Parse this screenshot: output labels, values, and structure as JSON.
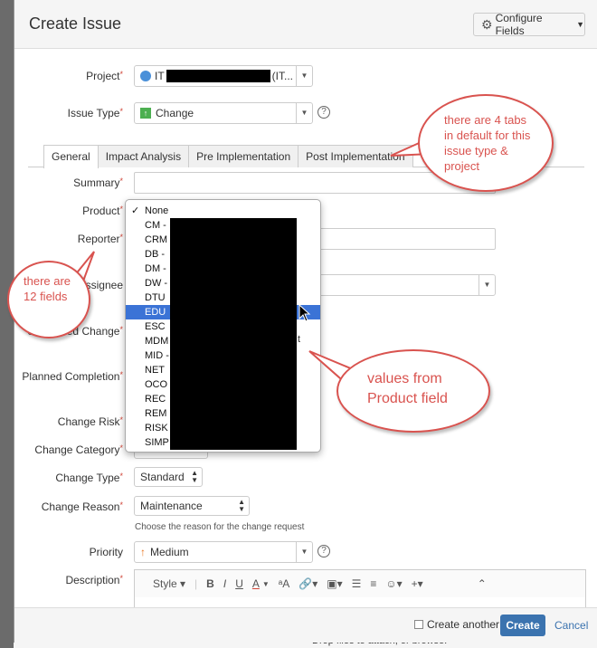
{
  "backdrop": {
    "strip_text": "Drop files to attach, or browse."
  },
  "dialog": {
    "title": "Create Issue",
    "configure_fields": "Configure Fields",
    "fields": {
      "project_label": "Project",
      "project_value": "IT",
      "project_suffix": "(IT...",
      "issue_type_label": "Issue Type",
      "issue_type_value": "Change",
      "summary_label": "Summary",
      "product_label": "Product",
      "reporter_label": "Reporter",
      "assignee_label": "Assignee",
      "scheduled_change_label": "Scheduled Change",
      "planned_completion_label": "Planned Completion",
      "change_risk_label": "Change Risk",
      "change_category_label": "Change Category",
      "change_type_label": "Change Type",
      "change_type_value": "Standard",
      "change_reason_label": "Change Reason",
      "change_reason_value": "Maintenance",
      "change_reason_hint": "Choose the reason for the change request",
      "priority_label": "Priority",
      "priority_value": "Medium",
      "description_label": "Description",
      "required_mark": "*",
      "help_glyph": "?"
    },
    "tabs": [
      "General",
      "Impact Analysis",
      "Pre Implementation",
      "Post Implementation"
    ],
    "editor": {
      "style": "Style",
      "bold": "B",
      "italic": "I",
      "underline": "U",
      "color": "A",
      "size": "ᵃA"
    },
    "footer": {
      "create_another": "Create another",
      "create": "Create",
      "cancel": "Cancel"
    }
  },
  "product_dropdown": {
    "options": [
      "None",
      "CM -",
      "CRM",
      "DB -",
      "DM -",
      "DW -",
      "DTU",
      "EDU",
      "ESC",
      "MDM",
      "MID -",
      "NET",
      "OCO",
      "REC",
      "REM",
      "RISK",
      "SIMP"
    ],
    "checked": "None",
    "highlighted": "EDU",
    "trailing_text_fragment": "t"
  },
  "annotations": {
    "tabs_note": "there are 4 tabs in default for this issue type & project",
    "fields_note": "there are 12 fields",
    "values_note": "values from Product field"
  },
  "colors": {
    "accent": "#3b73af",
    "highlight": "#3b73d6",
    "annotation": "#d9534f"
  }
}
